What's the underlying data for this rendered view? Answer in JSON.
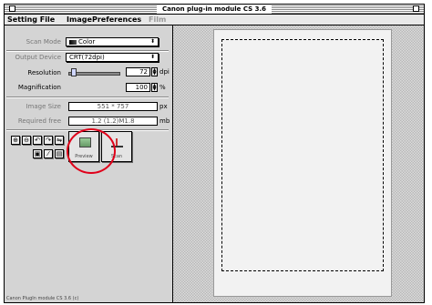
{
  "window": {
    "title": "Canon plug-in module CS 3.6"
  },
  "menubar": {
    "items": [
      "Setting File",
      "Image",
      "Preferences",
      "Film"
    ]
  },
  "scan_mode": {
    "label": "Scan Mode",
    "value": "Color"
  },
  "output_device": {
    "label": "Output Device",
    "value": "CRT(72dpi)"
  },
  "resolution": {
    "label": "Resolution",
    "value": "72",
    "unit": "dpi",
    "slider_fraction": 0.05
  },
  "magnification": {
    "label": "Magnification",
    "value": "100",
    "unit": "%"
  },
  "image_size": {
    "label": "Image Size",
    "value": "551 * 757",
    "unit": "px"
  },
  "required_free": {
    "label": "Required free",
    "value": "1.2 (1.2)M1.8",
    "unit": "mb"
  },
  "buttons": {
    "preview_label": "Preview",
    "scan_label": "Scan"
  },
  "status": {
    "text": "Canon PlugIn module CS 3.6 (c)"
  },
  "colors": {
    "annotation_circle": "#e0001a"
  }
}
